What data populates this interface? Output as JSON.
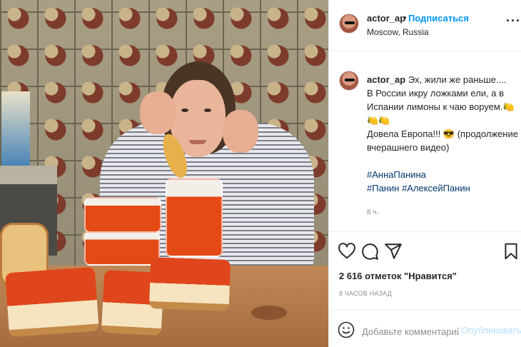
{
  "post": {
    "username": "actor_ap",
    "follow_label": "Подписаться",
    "location": "Moscow, Russia"
  },
  "caption": {
    "username": "actor_ap",
    "line1": "Эх, жили же раньше....",
    "line2": "В России икру ложками ели, а в Испании лимоны к чаю воруем.🍋",
    "line3": "🍋🍋",
    "line4": "Довела Европа!!! 😎 (продолжение вчерашнего видео)",
    "hashtag1": "#АннаПанина",
    "hashtag2": "#Панин",
    "hashtag3": "#АлексейПанин",
    "time_ago": "8 ч."
  },
  "likes": {
    "label": "2 616 отметок \"Нравится\""
  },
  "posted_ago": "8 часов назад",
  "comment": {
    "placeholder": "Добавьте комментарий...",
    "publish_label": "Опубликовать"
  },
  "icons": {
    "more": "more-options-icon",
    "like": "heart-icon",
    "comment": "comment-icon",
    "share": "share-icon",
    "save": "bookmark-icon",
    "emoji": "emoji-icon"
  },
  "colors": {
    "accent": "#0095f6",
    "publish_disabled": "#b2dffc",
    "hashtag": "#00376b",
    "muted": "#8e8e8e"
  }
}
